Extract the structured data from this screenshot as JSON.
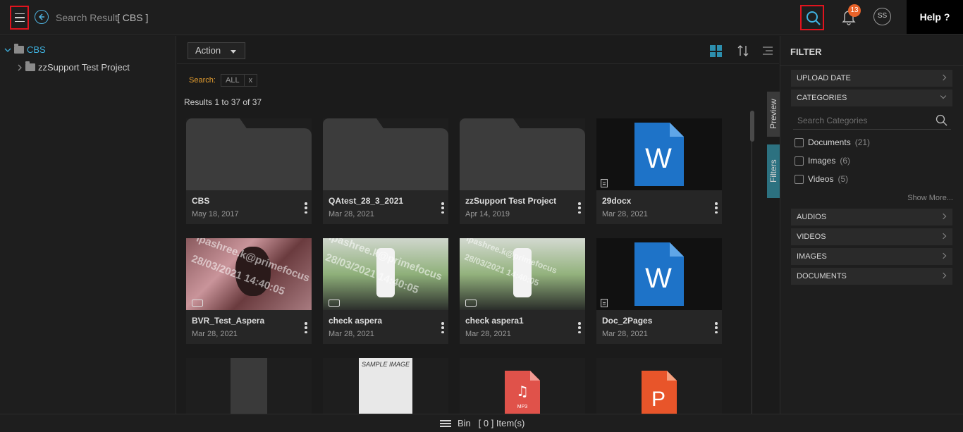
{
  "header": {
    "page_title": "Search Result",
    "context_tag": "[ CBS ]",
    "notification_count": "13",
    "user_initials": "SS",
    "help_label": "Help ?"
  },
  "tree": {
    "root": "CBS",
    "children": [
      "zzSupport Test Project"
    ]
  },
  "toolbar": {
    "action_label": "Action",
    "search_label": "Search:",
    "search_chip": "ALL",
    "search_chip_clear": "x",
    "results_text": "Results 1 to 37 of 37"
  },
  "side_tabs": {
    "preview": "Preview",
    "filters": "Filters"
  },
  "cards": [
    {
      "name": "CBS",
      "date": "May 18, 2017",
      "kind": "folder"
    },
    {
      "name": "QAtest_28_3_2021",
      "date": "Mar 28, 2021",
      "kind": "folder"
    },
    {
      "name": "zzSupport Test Project",
      "date": "Apr 14, 2019",
      "kind": "folder"
    },
    {
      "name": "29docx",
      "date": "Mar 28, 2021",
      "kind": "word"
    },
    {
      "name": "BVR_Test_Aspera",
      "date": "Mar 28, 2021",
      "kind": "video"
    },
    {
      "name": "check aspera",
      "date": "Mar 28, 2021",
      "kind": "video"
    },
    {
      "name": "check aspera1",
      "date": "Mar 28, 2021",
      "kind": "video"
    },
    {
      "name": "Doc_2Pages",
      "date": "Mar 28, 2021",
      "kind": "word"
    },
    {
      "name": "",
      "date": "",
      "kind": "image"
    },
    {
      "name": "",
      "date": "",
      "kind": "image"
    },
    {
      "name": "",
      "date": "",
      "kind": "audio"
    },
    {
      "name": "",
      "date": "",
      "kind": "powerpoint"
    }
  ],
  "thumb_text": {
    "word_letter": "W",
    "mp3_label": "MP3",
    "ppt_letter": "P",
    "sample_image": "SAMPLE IMAGE",
    "watermark_1": "ipashree.k@primefocus",
    "watermark_2": "28/03/2021 14:40:05"
  },
  "filter": {
    "title": "FILTER",
    "sections": [
      "UPLOAD DATE",
      "CATEGORIES",
      "AUDIOS",
      "VIDEOS",
      "IMAGES",
      "DOCUMENTS"
    ],
    "category_search_placeholder": "Search Categories",
    "categories": [
      {
        "label": "Documents",
        "count": "(21)"
      },
      {
        "label": "Images",
        "count": "(6)"
      },
      {
        "label": "Videos",
        "count": "(5)"
      }
    ],
    "show_more": "Show More..."
  },
  "bottom": {
    "bin_label": "Bin",
    "bin_count": "[ 0 ] Item(s)"
  },
  "colors": {
    "accent": "#2d8fae",
    "highlight": "#e0141e",
    "badge": "#e8632a",
    "word_blue": "#1e73c8",
    "mp3_red": "#e0524a",
    "ppt_orange": "#e8552a"
  }
}
